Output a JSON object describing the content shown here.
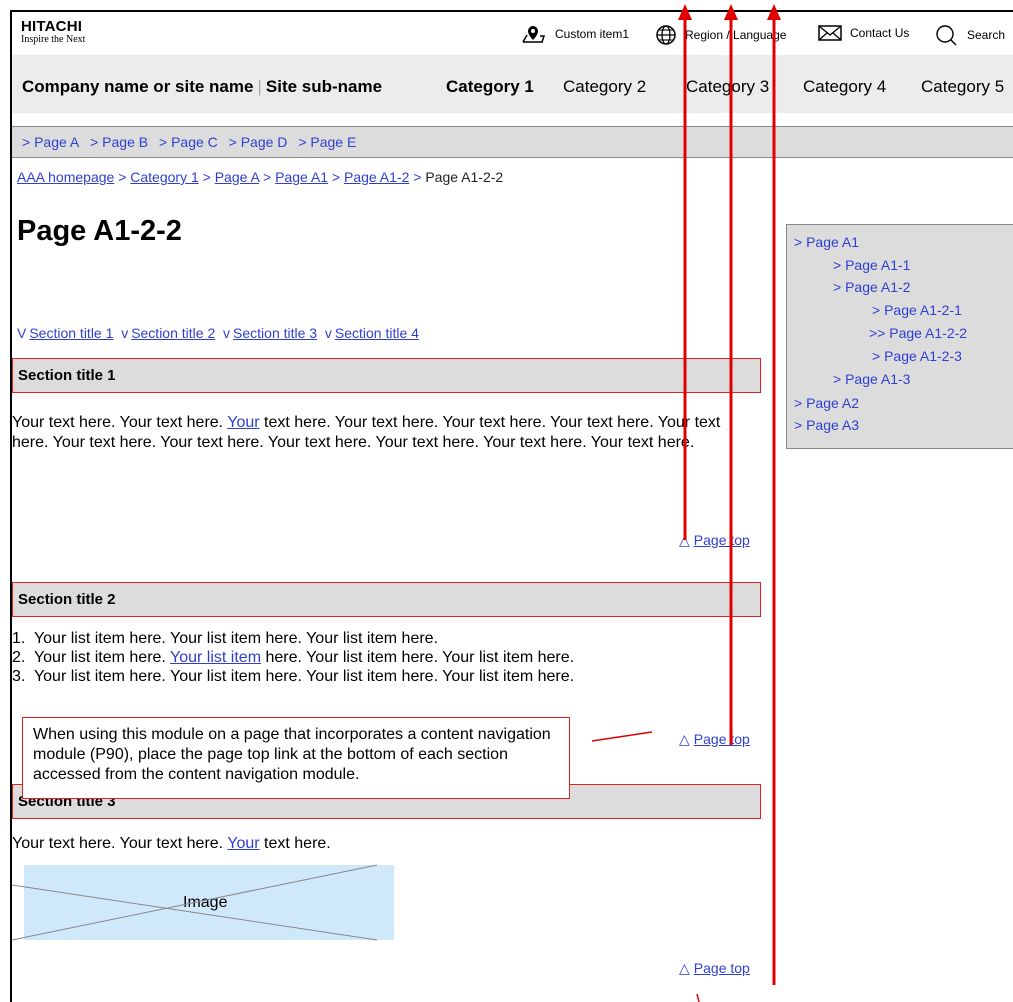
{
  "header": {
    "logo_line1": "HITACHI",
    "logo_line2": "Inspire the Next",
    "utility": {
      "custom_item": "Custom item1",
      "region_language": "Region / Language",
      "contact": "Contact Us",
      "search": "Search"
    }
  },
  "global_nav": {
    "site_name": "Company name or site name",
    "separator": "|",
    "site_sub_name": "Site sub-name",
    "categories": [
      "Category 1",
      "Category 2",
      "Category 3",
      "Category 4",
      "Category 5"
    ]
  },
  "local_nav": {
    "items": [
      "> Page A",
      "> Page B",
      "> Page C",
      "> Page D",
      "> Page E"
    ]
  },
  "breadcrumb": {
    "links": [
      "AAA homepage",
      "Category 1",
      "Page A",
      "Page A1",
      "Page A1-2"
    ],
    "sep": ">",
    "current": "Page A1-2-2"
  },
  "page_title": "Page A1-2-2",
  "anchors": [
    {
      "mark": "V",
      "label": "Section title 1"
    },
    {
      "mark": "v",
      "label": "Section title 2"
    },
    {
      "mark": "v",
      "label": "Section title 3"
    },
    {
      "mark": "v",
      "label": "Section title 4"
    }
  ],
  "sections": [
    {
      "title": "Section title 1",
      "text_before": "Your text here. Your text here. ",
      "text_link": "Your",
      "text_after": " text here. Your text here. Your text here. Your text here. Your text here. Your text here. Your text here. Your text here. Your text here. Your text here. Your text here."
    },
    {
      "title": "Section title 2",
      "list": [
        {
          "num": "1.",
          "before": "Your list item here. Your list item here. Your list item here.",
          "link": "",
          "after": ""
        },
        {
          "num": "2.",
          "before": "Your list item here. ",
          "link": "Your list item",
          "after": " here. Your list item here. Your list item here."
        },
        {
          "num": "3.",
          "before": "Your list item here. Your list item here. Your list item here. Your list item here.",
          "link": "",
          "after": ""
        }
      ]
    },
    {
      "title": "Section title 3",
      "text_before": "Your text here. Your text here. ",
      "text_link": "Your",
      "text_after": " text here.",
      "image_label": "Image"
    }
  ],
  "page_top": {
    "icon": "triangle-up-icon",
    "mark": "△",
    "label": "Page top"
  },
  "annotation_note": "When using this module on a page that incorporates a content navigation module (P90), place the page top link at the bottom of each section accessed from the content navigation module.",
  "side_nav": [
    {
      "label": "> Page A1"
    },
    {
      "label": "> Page A1-1"
    },
    {
      "label": "> Page A1-2"
    },
    {
      "label": "> Page A1-2-1"
    },
    {
      "label": ">> Page A1-2-2"
    },
    {
      "label": "> Page A1-2-3"
    },
    {
      "label": "> Page A1-3"
    },
    {
      "label": "> Page A2"
    },
    {
      "label": "> Page A3"
    }
  ],
  "colors": {
    "link": "#2f3fd0",
    "annotation_red": "#e00000",
    "section_border": "#dd2222",
    "image_fill": "#cfe9fb"
  }
}
